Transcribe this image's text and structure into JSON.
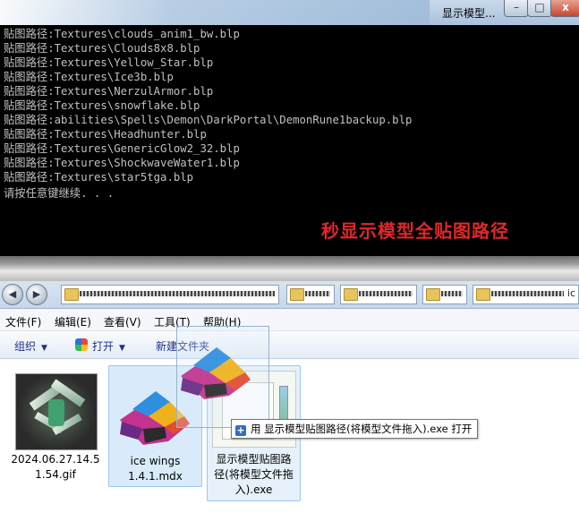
{
  "console": {
    "title": "显示模型...",
    "window_buttons": {
      "minimize": "–",
      "maximize": "□",
      "close": "x"
    },
    "lines": [
      "贴图路径:Textures\\clouds_anim1_bw.blp",
      "贴图路径:Textures\\Clouds8x8.blp",
      "贴图路径:Textures\\Yellow_Star.blp",
      "贴图路径:Textures\\Ice3b.blp",
      "贴图路径:Textures\\NerzulArmor.blp",
      "贴图路径:Textures\\snowflake.blp",
      "贴图路径:abilities\\Spells\\Demon\\DarkPortal\\DemonRune1backup.blp",
      "贴图路径:Textures\\Headhunter.blp",
      "贴图路径:Textures\\GenericGlow2_32.blp",
      "贴图路径:Textures\\ShockwaveWater1.blp",
      "贴图路径:Textures\\star5tga.blp"
    ],
    "prompt": "请按任意键继续. . .",
    "caption": "秒显示模型全贴图路径"
  },
  "address": {
    "tail_text": "ic"
  },
  "menu": {
    "file": "文件(F)",
    "edit": "编辑(E)",
    "view": "查看(V)",
    "tools": "工具(T)",
    "help": "帮助(H)"
  },
  "commands": {
    "organize": "组织",
    "open": "打开",
    "new_folder": "新建文件夹"
  },
  "files": [
    {
      "name": "2024.06.27.14.5\n1.54.gif"
    },
    {
      "name": "ice wings\n1.4.1.mdx"
    },
    {
      "name": "显示模型贴图路\n径(将模型文件拖\n入).exe"
    }
  ],
  "tooltip": {
    "text": "用 显示模型贴图路径(将模型文件拖入).exe 打开"
  },
  "colors": {
    "caption": "#e0282a",
    "console_text": "#c0c0c0",
    "selection": "#d9ebfb"
  }
}
